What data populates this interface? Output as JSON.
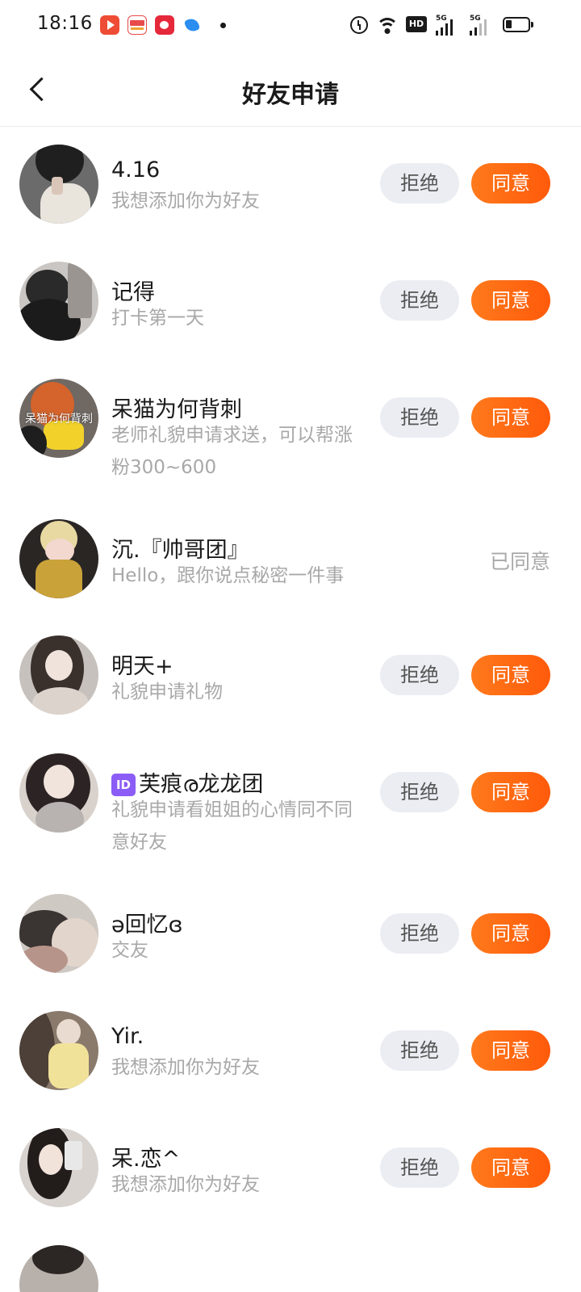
{
  "status_bar": {
    "time": "18:16",
    "notification_icons": [
      "video-app-icon",
      "toutiao-news-icon",
      "heart-app-icon",
      "blue-app-icon"
    ],
    "system_icons": [
      "alarm-icon",
      "wifi-icon",
      "hd-icon",
      "signal-5g-icon",
      "signal-5g-icon",
      "battery-icon"
    ],
    "hd_label": "HD",
    "sig1_label": "5G",
    "sig2_label": "5G"
  },
  "header": {
    "title": "好友申请",
    "back_icon": "chevron-left-icon"
  },
  "buttons": {
    "reject": "拒绝",
    "agree": "同意",
    "agreed": "已同意"
  },
  "accent_color": "#ff6410",
  "requests": [
    {
      "name": "4.16",
      "message": "我想添加你为好友",
      "state": "pending"
    },
    {
      "name": "记得",
      "message": "打卡第一天",
      "state": "pending"
    },
    {
      "name": "呆猫为何背刺",
      "message": "老师礼貌申请求送，可以帮涨粉300~600",
      "avatar_text": "呆猫为何背刺",
      "state": "pending"
    },
    {
      "name": "沉.『帅哥团』",
      "message": "Hello，跟你说点秘密一件事",
      "state": "agreed"
    },
    {
      "name": "明天+",
      "message": "礼貌申请礼物",
      "state": "pending"
    },
    {
      "name": "芙痕ര龙龙团",
      "badge": "ID",
      "message": "礼貌申请看姐姐的心情同不同意好友",
      "state": "pending"
    },
    {
      "name": "ә回忆ɞ",
      "message": "交友",
      "state": "pending"
    },
    {
      "name": "Yir.",
      "message": "我想添加你为好友",
      "state": "pending"
    },
    {
      "name": "呆.恋^",
      "message": "我想添加你为好友",
      "state": "pending"
    }
  ]
}
